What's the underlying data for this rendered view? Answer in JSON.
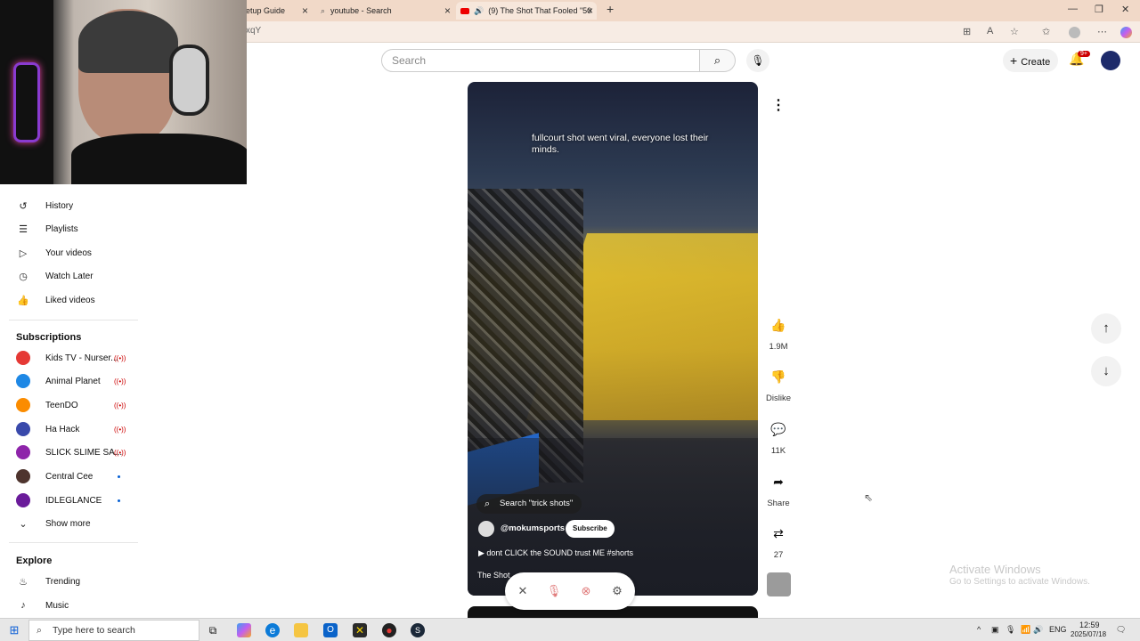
{
  "browser": {
    "tabs": [
      {
        "label": "etup Guide"
      },
      {
        "label": "youtube - Search"
      },
      {
        "label": "(9) The Shot That Fooled \"50"
      }
    ],
    "address": "xqY"
  },
  "header": {
    "search_placeholder": "Search",
    "create_label": "Create",
    "notif_badge": "9+"
  },
  "sidebar": {
    "you_items": [
      {
        "label": "History",
        "icon": "history-icon"
      },
      {
        "label": "Playlists",
        "icon": "playlist-icon"
      },
      {
        "label": "Your videos",
        "icon": "your-videos-icon"
      },
      {
        "label": "Watch Later",
        "icon": "clock-icon"
      },
      {
        "label": "Liked videos",
        "icon": "thumbs-up-icon"
      }
    ],
    "subscriptions_title": "Subscriptions",
    "subscriptions": [
      {
        "label": "Kids TV - Nurser...",
        "status": "live",
        "color": "#e53935"
      },
      {
        "label": "Animal Planet",
        "status": "live",
        "color": "#1e88e5"
      },
      {
        "label": "TeenDO",
        "status": "live",
        "color": "#fb8c00"
      },
      {
        "label": "Ha Hack",
        "status": "live",
        "color": "#3949ab"
      },
      {
        "label": "SLICK SLIME SA...",
        "status": "live",
        "color": "#8e24aa"
      },
      {
        "label": "Central Cee",
        "status": "new",
        "color": "#4e342e"
      },
      {
        "label": "IDLEGLANCE",
        "status": "new",
        "color": "#6a1b9a"
      }
    ],
    "show_more": "Show more",
    "explore_title": "Explore",
    "explore": [
      {
        "label": "Trending"
      },
      {
        "label": "Music"
      }
    ]
  },
  "video": {
    "caption": "fullcourt shot went viral, everyone lost their minds.",
    "search_chip": "Search \"trick shots\"",
    "channel": "@mokumsports",
    "subscribe": "Subscribe",
    "description": "dont CLICK the SOUND trust ME #shorts",
    "title_partial": "The Shot"
  },
  "actions": {
    "likes": "1.9M",
    "dislike": "Dislike",
    "comments": "11K",
    "share": "Share",
    "remix": "27"
  },
  "watermark": {
    "line1": "Activate Windows",
    "line2": "Go to Settings to activate Windows."
  },
  "taskbar": {
    "search_placeholder": "Type here to search",
    "lang": "ENG",
    "time": "12:59",
    "date": "2025/07/18"
  }
}
